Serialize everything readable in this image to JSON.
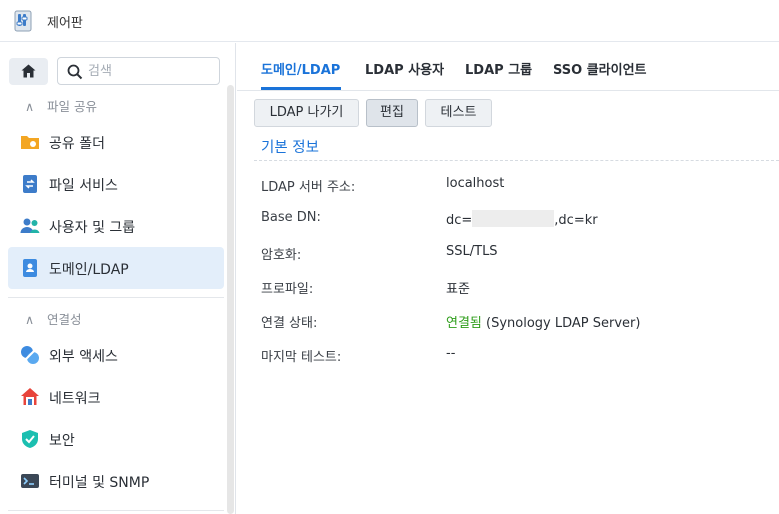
{
  "window": {
    "title": "제어판",
    "icon": "control-panel-icon"
  },
  "sidebar": {
    "search_placeholder": "검색",
    "sections": [
      {
        "label": "파일 공유"
      },
      {
        "label": "연결성"
      }
    ],
    "items": [
      {
        "label": "공유 폴더",
        "icon": "folder-share-icon"
      },
      {
        "label": "파일 서비스",
        "icon": "file-services-icon"
      },
      {
        "label": "사용자 및 그룹",
        "icon": "users-groups-icon"
      },
      {
        "label": "도메인/LDAP",
        "icon": "domain-ldap-icon",
        "active": true
      },
      {
        "label": "외부 액세스",
        "icon": "external-access-icon"
      },
      {
        "label": "네트워크",
        "icon": "network-icon"
      },
      {
        "label": "보안",
        "icon": "security-shield-icon"
      },
      {
        "label": "터미널 및 SNMP",
        "icon": "terminal-icon"
      }
    ]
  },
  "tabs": [
    {
      "label": "도메인/LDAP",
      "active": true
    },
    {
      "label": "LDAP 사용자"
    },
    {
      "label": "LDAP 그룹"
    },
    {
      "label": "SSO 클라이언트"
    }
  ],
  "toolbar": {
    "leave_label": "LDAP 나가기",
    "edit_label": "편집",
    "test_label": "테스트"
  },
  "info": {
    "title": "기본 정보",
    "rows": [
      {
        "label": "LDAP 서버 주소:",
        "value": "localhost"
      },
      {
        "label": "Base DN:",
        "value_prefix": "dc=",
        "value_suffix": ",dc=kr"
      },
      {
        "label": "암호화:",
        "value": "SSL/TLS"
      },
      {
        "label": "프로파일:",
        "value": "표준"
      },
      {
        "label": "연결 상태:",
        "status": "연결됨",
        "value": "(Synology LDAP Server)"
      },
      {
        "label": "마지막 테스트:",
        "value": "--"
      }
    ]
  },
  "colors": {
    "accent": "#1a73d9",
    "status_ok": "#2f9e1b",
    "active_bg": "#e3eefa"
  }
}
